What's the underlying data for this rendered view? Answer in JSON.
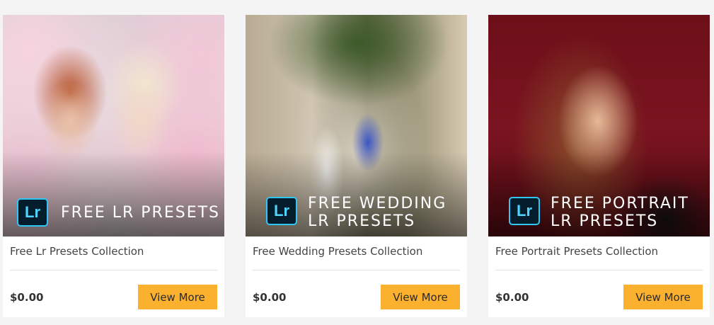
{
  "products": [
    {
      "badge": "Lr",
      "banner_line1": "FREE LR PRESETS",
      "banner_line2": "",
      "title": "Free Lr Presets Collection",
      "price": "$0.00",
      "button": "View More"
    },
    {
      "badge": "Lr",
      "banner_line1": "FREE WEDDING",
      "banner_line2": "LR PRESETS",
      "title": "Free Wedding Presets Collection",
      "price": "$0.00",
      "button": "View More"
    },
    {
      "badge": "Lr",
      "banner_line1": "FREE PORTRAIT",
      "banner_line2": "LR PRESETS",
      "title": "Free Portrait Presets Collection",
      "price": "$0.00",
      "button": "View More"
    }
  ],
  "colors": {
    "button": "#fbb12e",
    "badge_border": "#31c5f4",
    "badge_bg": "#031d2c"
  }
}
